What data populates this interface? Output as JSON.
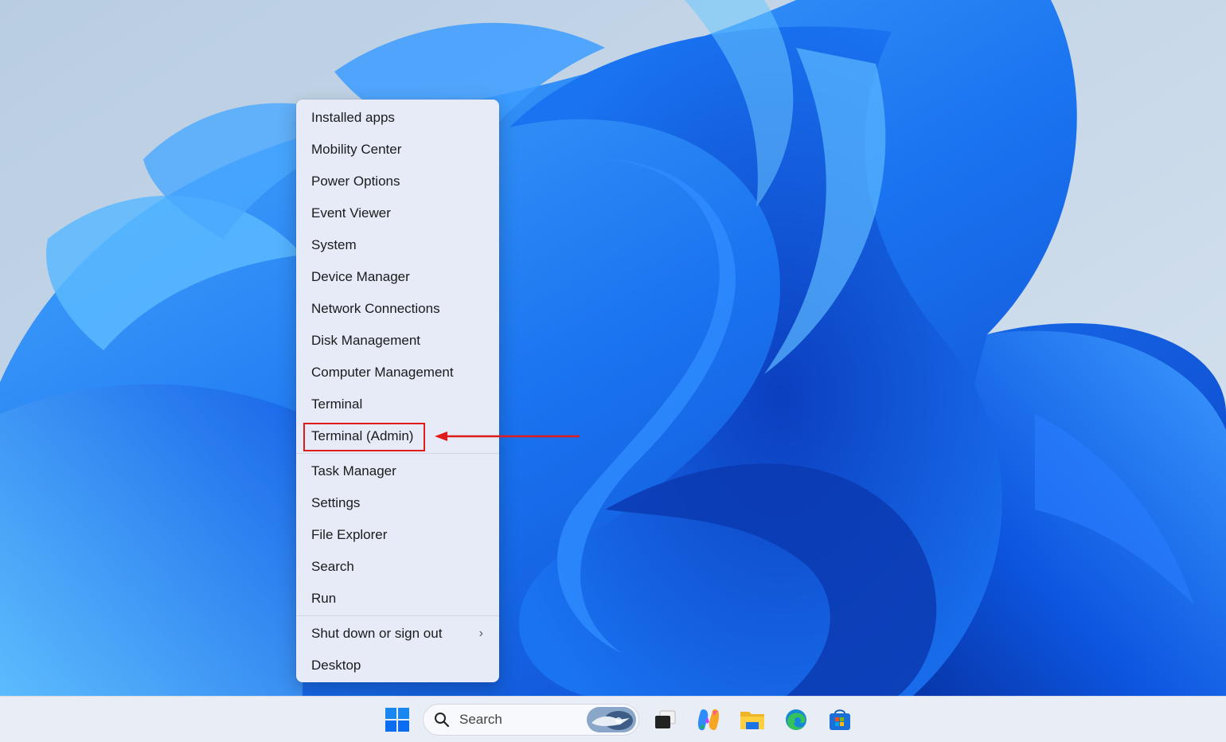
{
  "context_menu": {
    "group1": [
      "Installed apps",
      "Mobility Center",
      "Power Options",
      "Event Viewer",
      "System",
      "Device Manager",
      "Network Connections",
      "Disk Management",
      "Computer Management",
      "Terminal",
      "Terminal (Admin)"
    ],
    "group2": [
      "Task Manager",
      "Settings",
      "File Explorer",
      "Search",
      "Run"
    ],
    "group3": [
      "Shut down or sign out",
      "Desktop"
    ],
    "submenu_chevron": "›"
  },
  "annotation": {
    "highlighted_item": "Terminal (Admin)",
    "color": "#e01b1b"
  },
  "taskbar": {
    "search_placeholder": "Search",
    "icons": [
      "windows-start-icon",
      "search-icon",
      "task-view-icon",
      "copilot-icon",
      "file-explorer-icon",
      "edge-icon",
      "microsoft-store-icon"
    ]
  },
  "colors": {
    "menu_bg": "#e6ebf7",
    "taskbar_bg": "#e9eef6",
    "windows_blue": "#0a6cf0"
  }
}
